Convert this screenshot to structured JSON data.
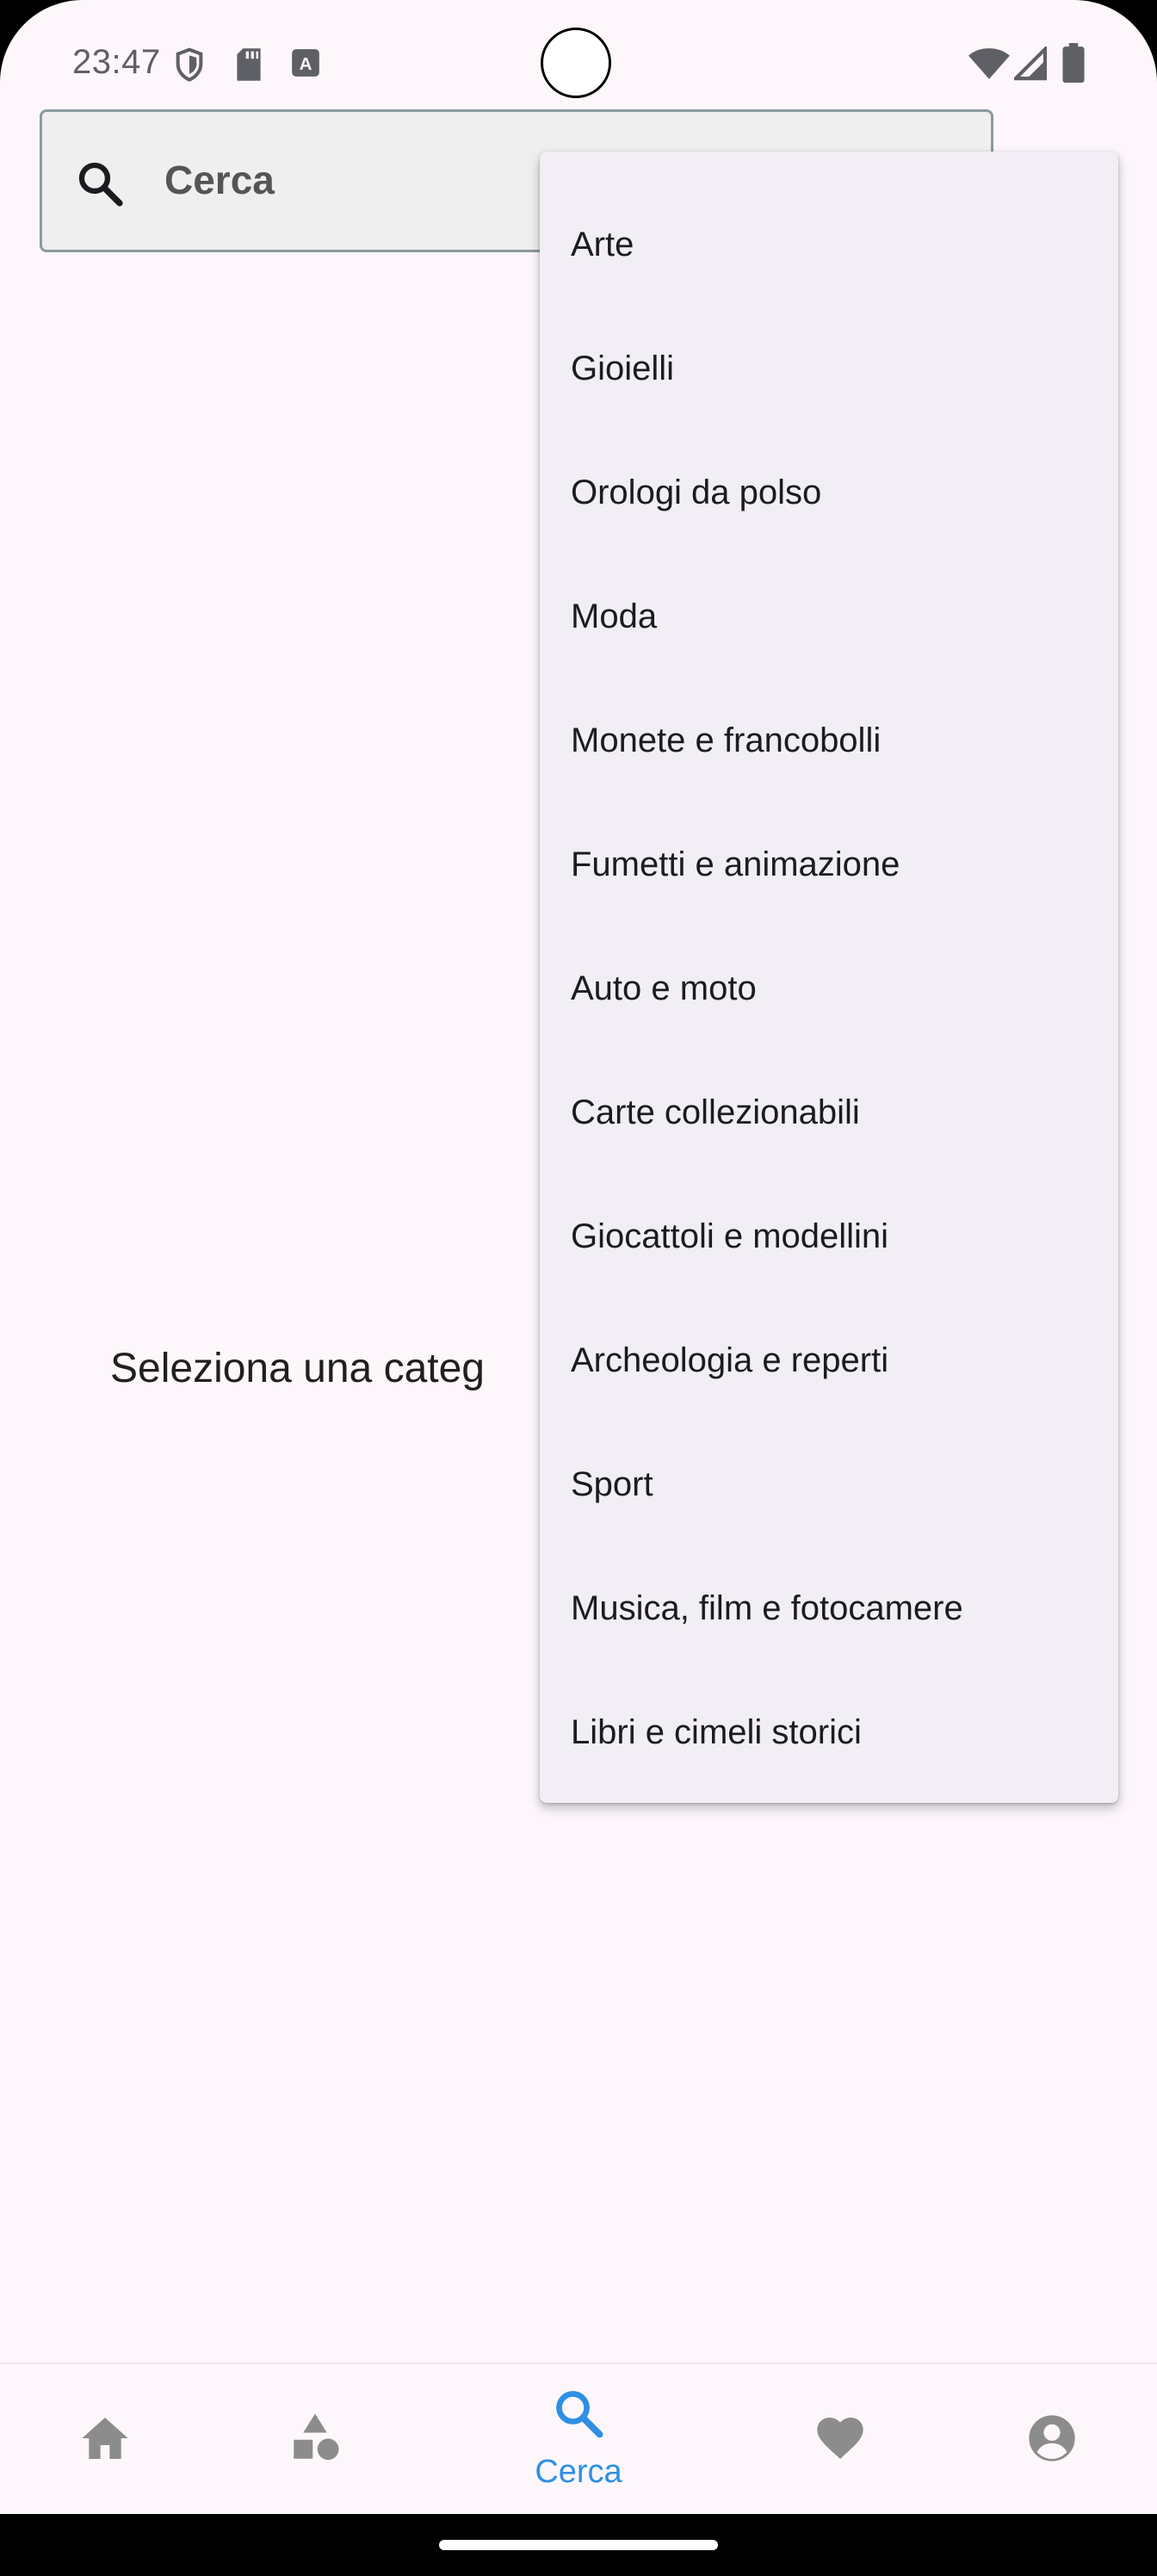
{
  "status_bar": {
    "time": "23:47",
    "left_icons": [
      "shield-icon",
      "sd-card-icon",
      "keyboard-a-icon"
    ],
    "right_icons": [
      "wifi-icon",
      "cell-signal-icon",
      "battery-icon"
    ]
  },
  "search": {
    "value": "Cerca",
    "icon": "search-icon"
  },
  "hint_text": "Seleziona una categ",
  "dropdown": {
    "items": [
      "Arte",
      "Gioielli",
      "Orologi da polso",
      "Moda",
      "Monete e francobolli",
      "Fumetti e animazione",
      "Auto e moto",
      "Carte collezionabili",
      "Giocattoli e modellini",
      "Archeologia e reperti",
      "Sport",
      "Musica, film e fotocamere",
      "Libri e cimeli storici"
    ]
  },
  "bottom_nav": {
    "items": [
      {
        "icon": "home-icon",
        "label": ""
      },
      {
        "icon": "categories-icon",
        "label": ""
      },
      {
        "icon": "search-icon",
        "label": "Cerca",
        "selected": true
      },
      {
        "icon": "heart-icon",
        "label": ""
      },
      {
        "icon": "account-icon",
        "label": ""
      }
    ],
    "active_color": "#2f8fe3",
    "inactive_color": "#8c8c8c"
  }
}
